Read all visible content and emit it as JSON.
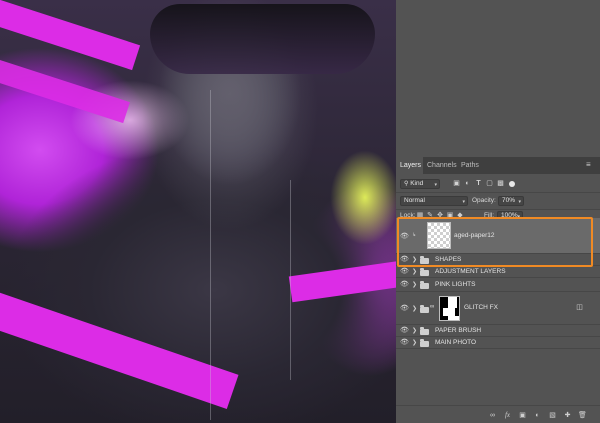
{
  "panel": {
    "tabs": [
      {
        "label": "Layers",
        "active": true
      },
      {
        "label": "Channels",
        "active": false
      },
      {
        "label": "Paths",
        "active": false
      }
    ],
    "menu_icon": "panel-menu-icon",
    "filter": {
      "kind_label": "Kind",
      "icons": [
        "pixel-filter-icon",
        "adjustment-filter-icon",
        "type-filter-icon",
        "shape-filter-icon",
        "smart-object-filter-icon",
        "filter-toggle-icon"
      ]
    },
    "blend": {
      "mode": "Normal",
      "opacity_label": "Opacity:",
      "opacity": "70%"
    },
    "lock": {
      "label": "Lock:",
      "icons": [
        "lock-transparency-icon",
        "lock-pixels-icon",
        "lock-position-icon",
        "lock-artboard-icon",
        "lock-all-icon"
      ],
      "fill_label": "Fill:",
      "fill": "100%"
    },
    "layers": [
      {
        "name": "aged-paper12",
        "type": "pixel",
        "selected": true
      },
      {
        "name": "SHAPES",
        "type": "group"
      },
      {
        "name": "ADJUSTMENT LAYERS",
        "type": "group"
      },
      {
        "name": "PINK LIGHTS",
        "type": "group"
      },
      {
        "name": "GLITCH FX",
        "type": "group-mask"
      },
      {
        "name": "PAPER BRUSH",
        "type": "group"
      },
      {
        "name": "MAIN PHOTO",
        "type": "group"
      }
    ],
    "bottom_icons": [
      "link-layers-icon",
      "fx-icon",
      "add-mask-icon",
      "adjustment-layer-icon",
      "new-group-icon",
      "new-layer-icon",
      "delete-layer-icon"
    ],
    "fx_label": "fx"
  },
  "colors": {
    "highlight": "#f08a24",
    "panel_bg": "#535353",
    "selected_row": "#6a6a6a",
    "accent_magenta": "#dc2ce6"
  }
}
